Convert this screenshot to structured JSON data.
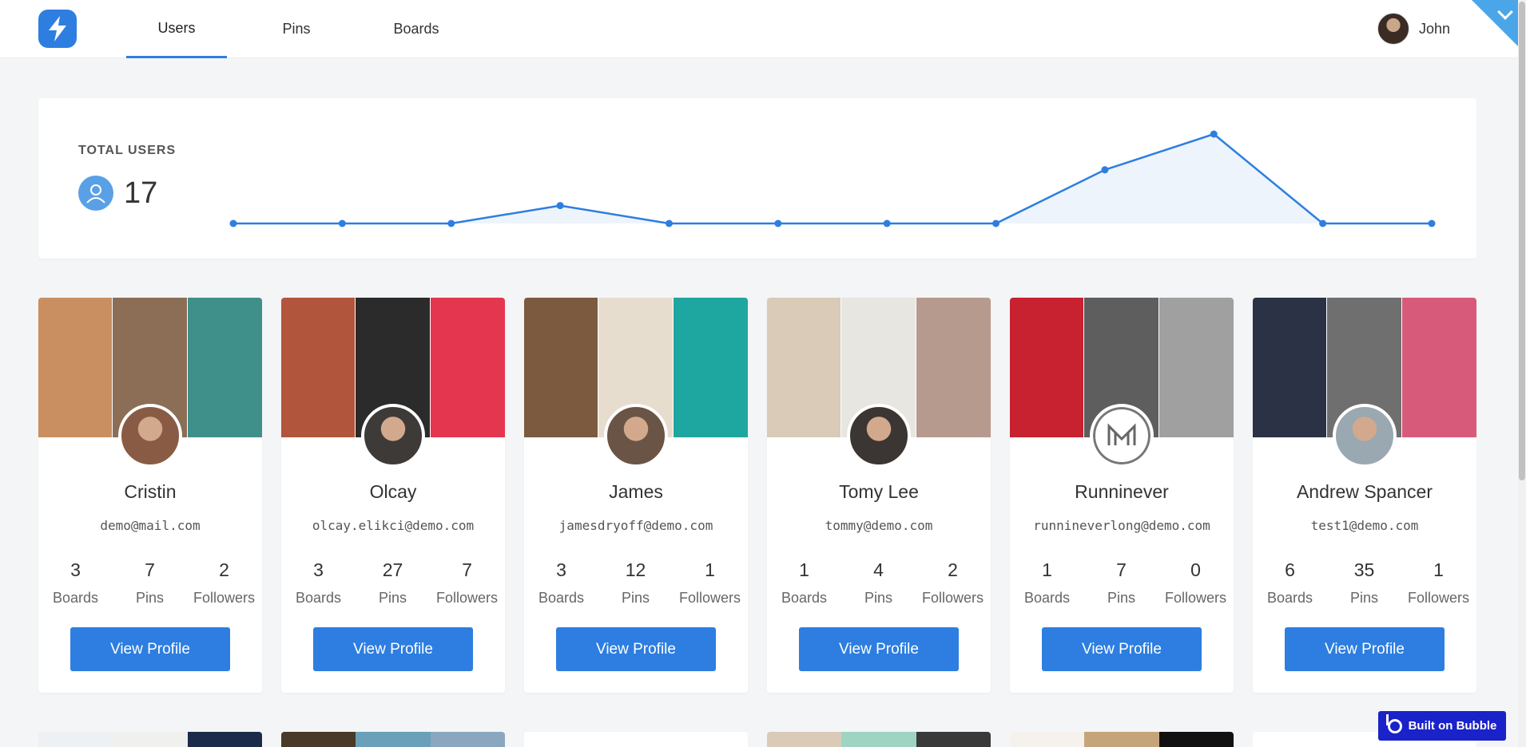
{
  "nav": {
    "tabs": [
      {
        "label": "Users",
        "active": true
      },
      {
        "label": "Pins",
        "active": false
      },
      {
        "label": "Boards",
        "active": false
      }
    ],
    "user_name": "John"
  },
  "stats": {
    "label": "TOTAL USERS",
    "count": "17"
  },
  "chart_data": {
    "type": "area",
    "series": [
      {
        "values": [
          0,
          0,
          0,
          1,
          0,
          0,
          0,
          0,
          3,
          5,
          0,
          0
        ]
      }
    ],
    "ylim": [
      0,
      5
    ],
    "grid": false,
    "color": "#2d7ee0"
  },
  "cards": [
    {
      "name": "Cristin",
      "email": "demo@mail.com",
      "boards": "3",
      "pins": "7",
      "followers": "2",
      "covers": [
        "#c98f61",
        "#8b6e55",
        "#3f8f8a"
      ],
      "avatar": "#8a5b44"
    },
    {
      "name": "Olcay",
      "email": "olcay.elikci@demo.com",
      "boards": "3",
      "pins": "27",
      "followers": "7",
      "covers": [
        "#b2553d",
        "#2b2b2b",
        "#e4374f"
      ],
      "avatar": "#3d3a38"
    },
    {
      "name": "James",
      "email": "jamesdryoff@demo.com",
      "boards": "3",
      "pins": "12",
      "followers": "1",
      "covers": [
        "#7b5a3f",
        "#e7ddcf",
        "#1ea6a0"
      ],
      "avatar": "#6a5446"
    },
    {
      "name": "Tomy Lee",
      "email": "tommy@demo.com",
      "boards": "1",
      "pins": "4",
      "followers": "2",
      "covers": [
        "#d9cbb8",
        "#e8e6e1",
        "#b79a8e"
      ],
      "avatar": "#3b3633"
    },
    {
      "name": "Runninever",
      "email": "runnineverlong@demo.com",
      "boards": "1",
      "pins": "7",
      "followers": "0",
      "covers": [
        "#c8212f",
        "#5e5e5e",
        "#a0a0a0"
      ],
      "avatar": "#ffffff"
    },
    {
      "name": "Andrew Spancer",
      "email": "test1@demo.com",
      "boards": "6",
      "pins": "35",
      "followers": "1",
      "covers": [
        "#2b3246",
        "#6f6f6f",
        "#d85a7a"
      ],
      "avatar": "#9aa8b1"
    }
  ],
  "labels": {
    "boards": "Boards",
    "pins": "Pins",
    "followers": "Followers",
    "view_profile": "View Profile"
  },
  "badge": "Built on Bubble"
}
